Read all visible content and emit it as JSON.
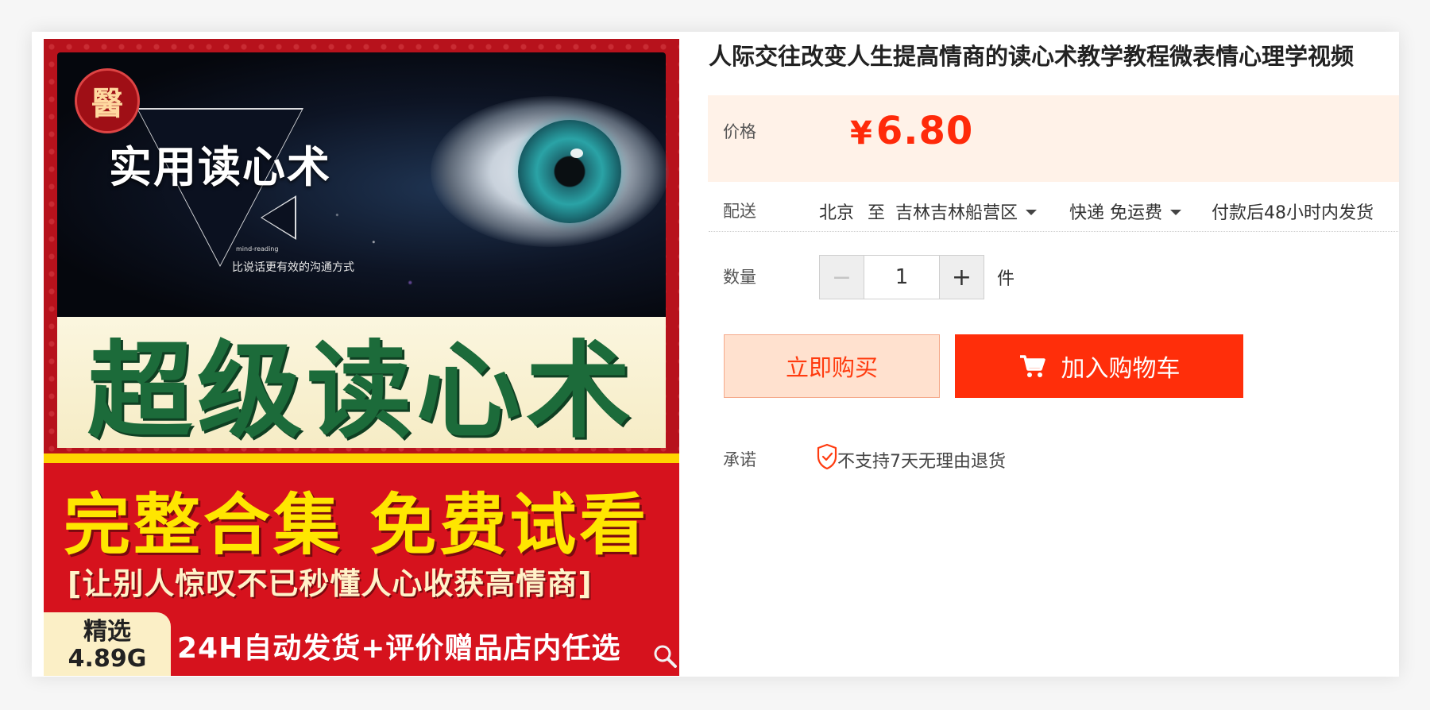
{
  "product_image": {
    "promo_title": "实用读心术",
    "promo_small_en": "mind-reading",
    "promo_sub": "比说话更有效的沟通方式",
    "big_title": "超级读心术",
    "yellow_title": "完整合集 免费试看",
    "bracket_line": "[让别人惊叹不已秒懂人心收获高情商]",
    "tag_line1": "精选",
    "tag_line2": "4.89G",
    "bottom_line": "24H自动发货+评价赠品店内任选",
    "seal_char": "醫"
  },
  "title": "人际交往改变人生提高情商的读心术教学教程微表情心理学视频",
  "price": {
    "label": "价格",
    "currency": "¥",
    "value": "6.80"
  },
  "shipping": {
    "label": "配送",
    "from": "北京",
    "to_word": "至",
    "destination": "吉林吉林船营区",
    "method": "快递 免运费",
    "dispatch": "付款后48小时内发货"
  },
  "quantity": {
    "label": "数量",
    "value": "1",
    "minus": "−",
    "plus": "+",
    "unit": "件"
  },
  "buttons": {
    "buy_now": "立即购买",
    "add_to_cart": "加入购物车"
  },
  "promise": {
    "label": "承诺",
    "text": "不支持7天无理由退货"
  },
  "colors": {
    "accent": "#ff2e0a",
    "price_bg": "#fff2e8",
    "buy_bg": "#ffe1cf"
  },
  "icons": [
    "zoom-icon",
    "cart-icon",
    "shield-check-icon",
    "caret-down-icon"
  ]
}
